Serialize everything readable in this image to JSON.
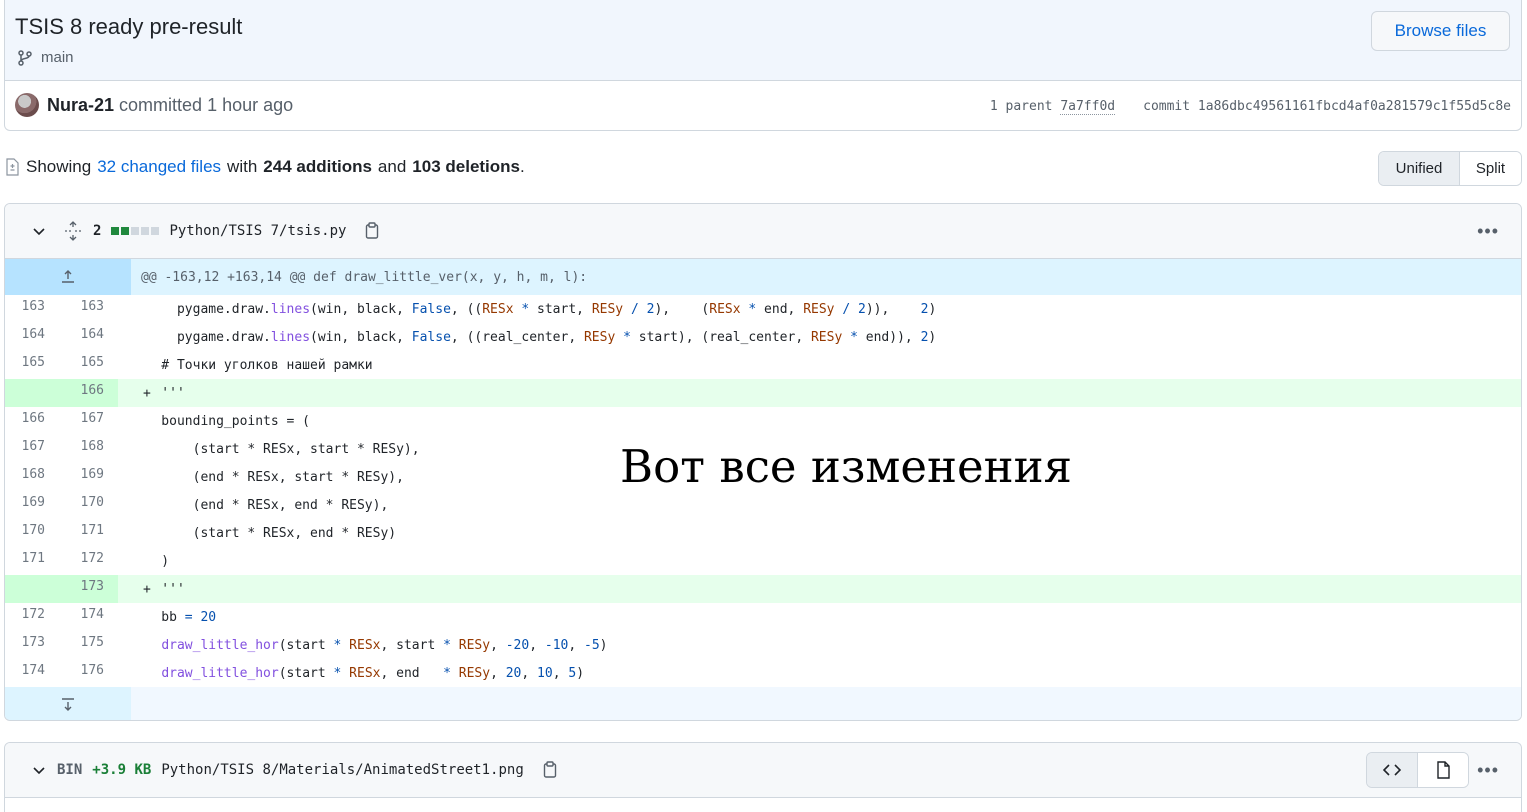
{
  "commit": {
    "title": "TSIS 8 ready pre-result",
    "branch": "main",
    "browse_label": "Browse files",
    "author": "Nura-21",
    "committed_text": "committed 1 hour ago",
    "parent_label": "1 parent",
    "parent_sha": "7a7ff0d",
    "commit_label": "commit",
    "commit_sha": "1a86dbc49561161fbcd4af0a281579c1f55d5c8e"
  },
  "summary": {
    "showing": "Showing",
    "changed_files": "32 changed files",
    "with": "with",
    "additions": "244 additions",
    "and": "and",
    "deletions": "103 deletions",
    "period": "."
  },
  "view_toggle": {
    "unified": "Unified",
    "split": "Split",
    "active": "Unified"
  },
  "file1": {
    "change_count": "2",
    "path": "Python/TSIS 7/tsis.py",
    "hunk_header": "@@ -163,12 +163,14 @@ def draw_little_ver(x, y, h, m, l):",
    "lines": [
      {
        "old": "163",
        "new": "163",
        "sign": "",
        "type": "ctx"
      },
      {
        "old": "164",
        "new": "164",
        "sign": "",
        "type": "ctx"
      },
      {
        "old": "165",
        "new": "165",
        "sign": "",
        "type": "ctx",
        "text": "    # Точки уголков нашей рамки"
      },
      {
        "old": "",
        "new": "166",
        "sign": "+",
        "type": "add",
        "text": "    '''"
      },
      {
        "old": "166",
        "new": "167",
        "sign": "",
        "type": "ctx",
        "text": "    bounding_points = ("
      },
      {
        "old": "167",
        "new": "168",
        "sign": "",
        "type": "ctx",
        "text": "        (start * RESx, start * RESy),"
      },
      {
        "old": "168",
        "new": "169",
        "sign": "",
        "type": "ctx",
        "text": "        (end * RESx, start * RESy),"
      },
      {
        "old": "169",
        "new": "170",
        "sign": "",
        "type": "ctx",
        "text": "        (end * RESx, end * RESy),"
      },
      {
        "old": "170",
        "new": "171",
        "sign": "",
        "type": "ctx",
        "text": "        (start * RESx, end * RESy)"
      },
      {
        "old": "171",
        "new": "172",
        "sign": "",
        "type": "ctx",
        "text": "    )"
      },
      {
        "old": "",
        "new": "173",
        "sign": "+",
        "type": "add",
        "text": "    '''"
      },
      {
        "old": "172",
        "new": "174",
        "sign": "",
        "type": "ctx"
      },
      {
        "old": "173",
        "new": "175",
        "sign": "",
        "type": "ctx"
      },
      {
        "old": "174",
        "new": "176",
        "sign": "",
        "type": "ctx"
      }
    ]
  },
  "overlay": "Вот все изменения",
  "file2": {
    "bin_label": "BIN",
    "size": "+3.9 KB",
    "path": "Python/TSIS 8/Materials/AnimatedStreet1.png"
  },
  "colors": {
    "accent": "#0969da",
    "added_bg": "#e6ffec",
    "hunk_bg": "#ddf4ff"
  }
}
